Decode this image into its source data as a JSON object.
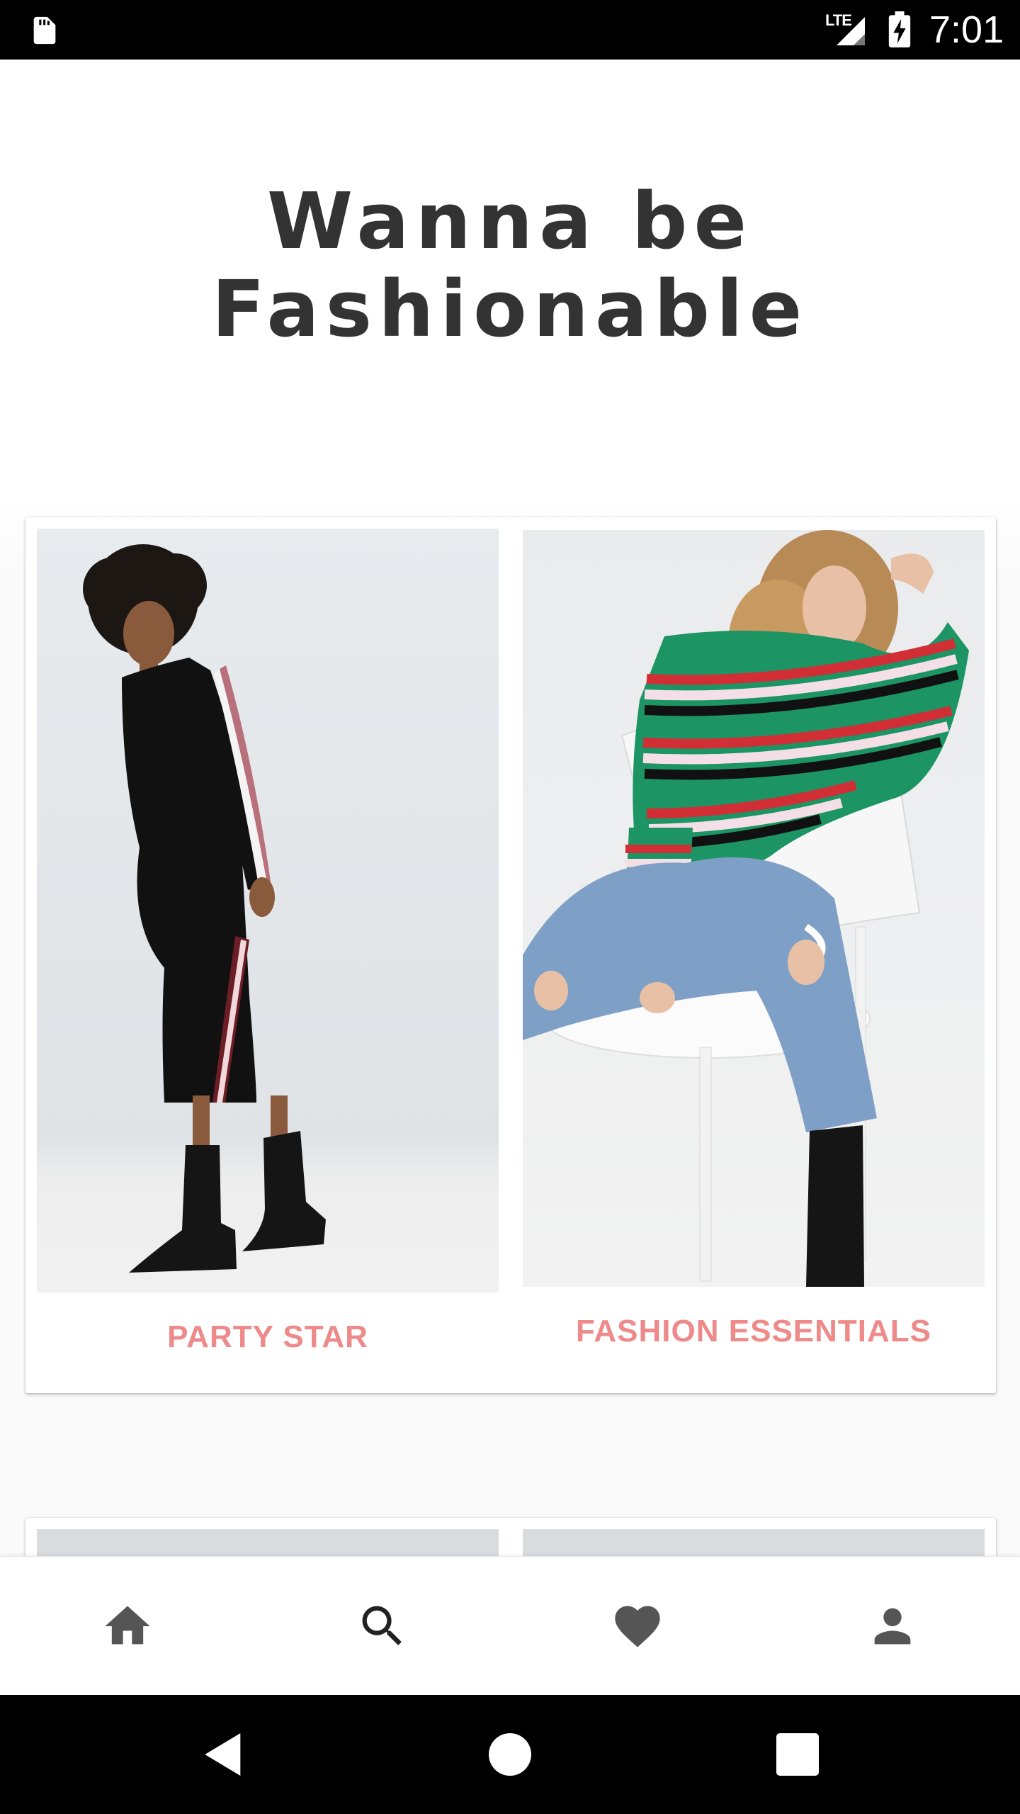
{
  "status_bar": {
    "time": "7:01",
    "network": "LTE",
    "icons": [
      "sd-card-icon",
      "signal-icon",
      "battery-charging-icon"
    ]
  },
  "headline": {
    "line1": "Wanna be",
    "line2": "Fashionable"
  },
  "categories": [
    {
      "label": "PARTY STAR",
      "image": "model-black-midi-dress-with-striped-sleeves"
    },
    {
      "label": "FASHION ESSENTIALS",
      "image": "model-green-striped-sweater-ripped-jeans"
    }
  ],
  "bottom_nav": {
    "items": [
      "home-icon",
      "search-icon",
      "heart-icon",
      "person-icon"
    ]
  },
  "system_nav": {
    "items": [
      "back-icon",
      "home-circle-icon",
      "recents-icon"
    ]
  },
  "colors": {
    "label_accent": "#ee8a8a",
    "headline_text": "#333333",
    "nav_icon": "#555555"
  }
}
